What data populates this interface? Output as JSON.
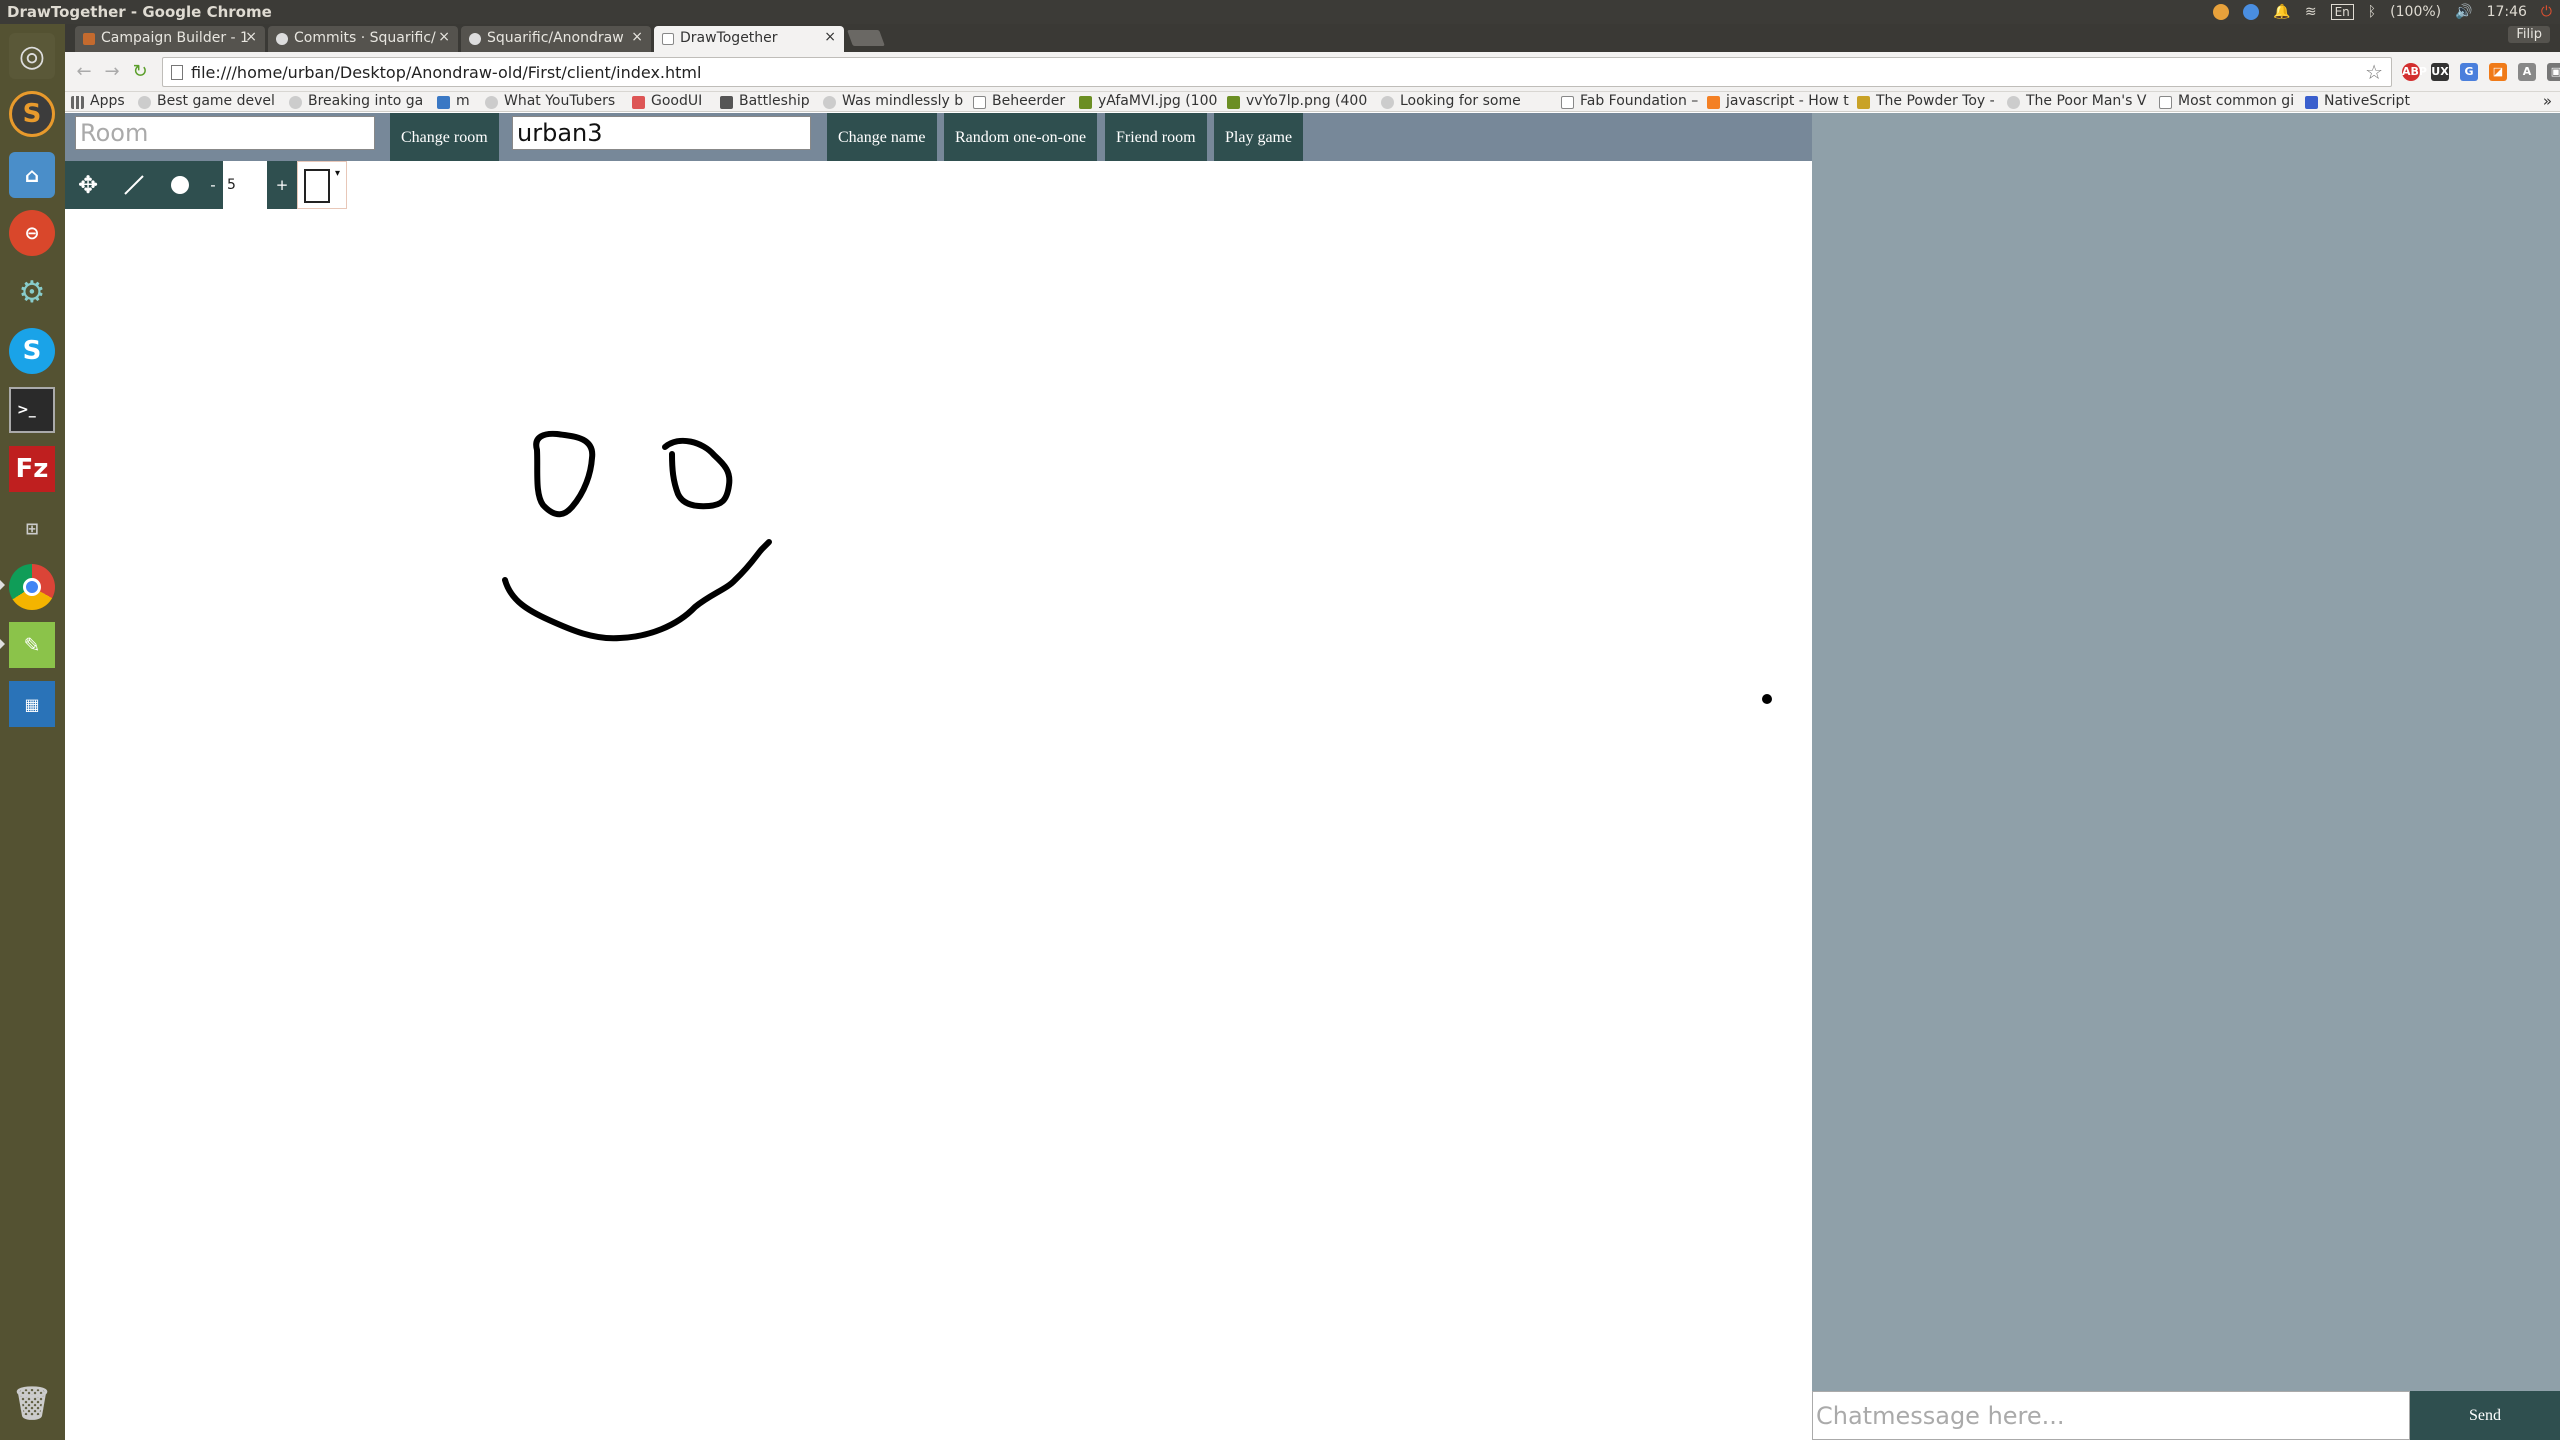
{
  "os_bar": {
    "window_title": "DrawTogether - Google Chrome",
    "battery": "(100%)",
    "keyboard": "En",
    "clock": "17:46"
  },
  "browser": {
    "tabs": [
      {
        "label": "Campaign Builder - 1",
        "active": false
      },
      {
        "label": "Commits · Squarific/",
        "active": false
      },
      {
        "label": "Squarific/Anondraw",
        "active": false
      },
      {
        "label": "DrawTogether",
        "active": true
      }
    ],
    "user": "Filip",
    "url": "file:///home/urban/Desktop/Anondraw-old/First/client/index.html",
    "bookmarks": [
      {
        "label": "Apps",
        "icon": "apps-grid-icon"
      },
      {
        "label": "Best game devel",
        "icon": "reddit-icon"
      },
      {
        "label": "Breaking into ga",
        "icon": "reddit-icon"
      },
      {
        "label": "m",
        "icon": "bookmark-icon"
      },
      {
        "label": "What YouTubers",
        "icon": "reddit-icon"
      },
      {
        "label": "GoodUI",
        "icon": "bookmark-icon"
      },
      {
        "label": "Battleship",
        "icon": "battleship-icon"
      },
      {
        "label": "Was mindlessly b",
        "icon": "reddit-icon"
      },
      {
        "label": "Beheerder",
        "icon": "page-icon"
      },
      {
        "label": "yAfaMVI.jpg (100",
        "icon": "image-icon"
      },
      {
        "label": "vvYo7lp.png (400",
        "icon": "image-icon"
      },
      {
        "label": "Looking for some",
        "icon": "reddit-icon"
      },
      {
        "label": "Fab Foundation –",
        "icon": "page-icon"
      },
      {
        "label": "javascript - How t",
        "icon": "stackoverflow-icon"
      },
      {
        "label": "The Powder Toy -",
        "icon": "powdertoy-icon"
      },
      {
        "label": "The Poor Man's V",
        "icon": "reddit-icon"
      },
      {
        "label": "Most common gi",
        "icon": "page-icon"
      },
      {
        "label": "NativeScript",
        "icon": "nativescript-icon"
      }
    ],
    "bookmarks_more": "»"
  },
  "app": {
    "room_placeholder": "Room",
    "change_room_label": "Change room",
    "name_value": "urban3",
    "change_name_label": "Change name",
    "random_label": "Random one-on-one",
    "friend_room_label": "Friend room",
    "play_game_label": "Play game",
    "tools": {
      "move_icon": "move-arrows-icon",
      "line_icon": "line-tool-icon",
      "brush_icon": "brush-circle-icon",
      "minus_label": "-",
      "size_value": "5",
      "plus_label": "+",
      "color_arrow": "▾"
    },
    "drawing_color": "#000000",
    "chat_placeholder": "Chatmessage here...",
    "send_label": "Send"
  },
  "colors": {
    "toolbar_bg": "#778899",
    "button_bg": "#2f4f4f",
    "chat_panel_bg": "#8fa0a9",
    "launcher_bg": "#545232"
  }
}
